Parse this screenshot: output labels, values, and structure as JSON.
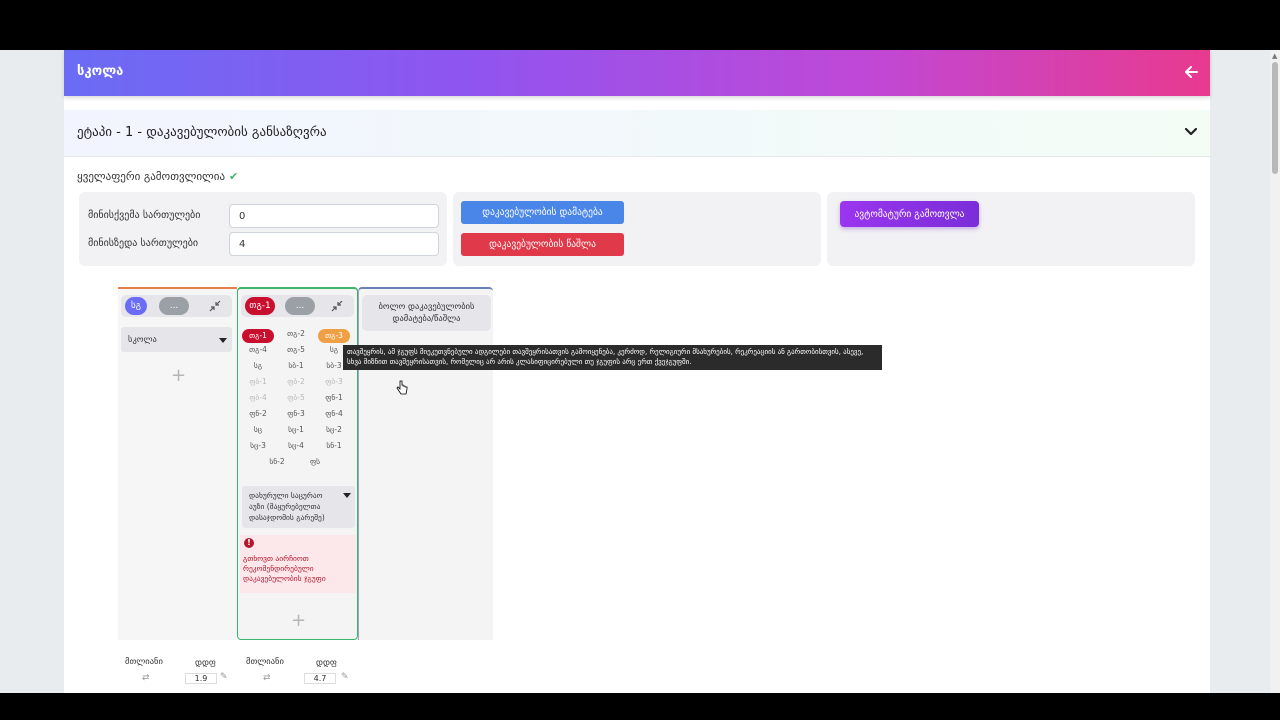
{
  "header": {
    "title": "სკოლა",
    "back_icon": "arrow-left-icon"
  },
  "stage": {
    "title": "ეტაპი - 1 - დაკავებულობის განსაზღვრა",
    "expand_icon": "chevron-down-icon"
  },
  "status": {
    "text": "ყველაფერი გამოთვლილია",
    "check": "✔"
  },
  "floors": {
    "min_label": "მინისქვემა სართულები",
    "min_value": "0",
    "max_label": "მინისზედა სართულები",
    "max_value": "4"
  },
  "buttons": {
    "add": "დაკავებულობის დამატება",
    "delete": "დაკავებულობის წაშლა",
    "auto": "ავტომატური გამოთვლა"
  },
  "col1": {
    "pill": "სგ",
    "more": "...",
    "dropdown": "სკოლა",
    "plus": "+"
  },
  "col2": {
    "pill": "თგ-1",
    "more": "...",
    "tags": [
      {
        "t": "თგ-1",
        "s": "sel"
      },
      {
        "t": "თგ-2",
        "s": ""
      },
      {
        "t": "თგ-3",
        "s": "hov"
      },
      {
        "t": "თგ-4",
        "s": ""
      },
      {
        "t": "თგ-5",
        "s": ""
      },
      {
        "t": "სგ",
        "s": ""
      },
      {
        "t": "სგ",
        "s": ""
      },
      {
        "t": "სბ-1",
        "s": ""
      },
      {
        "t": "სბ-3",
        "s": ""
      },
      {
        "t": "ფბ-1",
        "s": "dim"
      },
      {
        "t": "ფბ-2",
        "s": "dim"
      },
      {
        "t": "ფბ-3",
        "s": "dim"
      },
      {
        "t": "ფბ-4",
        "s": "dim"
      },
      {
        "t": "ფბ-5",
        "s": "dim"
      },
      {
        "t": "ფნ-1",
        "s": ""
      },
      {
        "t": "ფნ-2",
        "s": ""
      },
      {
        "t": "ფნ-3",
        "s": ""
      },
      {
        "t": "ფნ-4",
        "s": ""
      },
      {
        "t": "სც",
        "s": ""
      },
      {
        "t": "სც-1",
        "s": ""
      },
      {
        "t": "სც-2",
        "s": ""
      },
      {
        "t": "სც-3",
        "s": ""
      },
      {
        "t": "სც-4",
        "s": ""
      },
      {
        "t": "სნ-1",
        "s": ""
      },
      {
        "t": "სნ-2",
        "s": ""
      },
      {
        "t": "ფს",
        "s": ""
      }
    ],
    "dropdown": "დახურული საცურაო აუზი (მაყურებელთა დასაჯდომის გარეშე)",
    "warning": "გთხოვთ აირჩიოთ რეკომენდირებული დაკავებულობის ჯგუფი",
    "plus": "+"
  },
  "col3": {
    "text": "ბოლო დაკავებულობის დამატება/წაშლა"
  },
  "tooltip": "თავშეყრის, ამ ჯგუფს მიეკუთვნებული ადგილები თავშეყრისათვის გამოიყენება, კერძოდ, რელიგიური მსახურების, რეკრეაციის ან გართობისთვის, ასევე, სხვა მიზნით თავშეყრისათვის, რომელიც არ არის კლასიფიცირებული თუ ჯგუფის არც ერთ ქვეჯგუფში.",
  "summary": [
    {
      "total": "მთლიანი",
      "label": "დდფ",
      "value": "1.9"
    },
    {
      "total": "მთლიანი",
      "label": "დდფ",
      "value": "4.7"
    }
  ],
  "colors": {
    "accent_blue": "#4a86e8",
    "danger": "#e03a4a",
    "purple": "#8a2be2",
    "selected": "#c8102e"
  }
}
